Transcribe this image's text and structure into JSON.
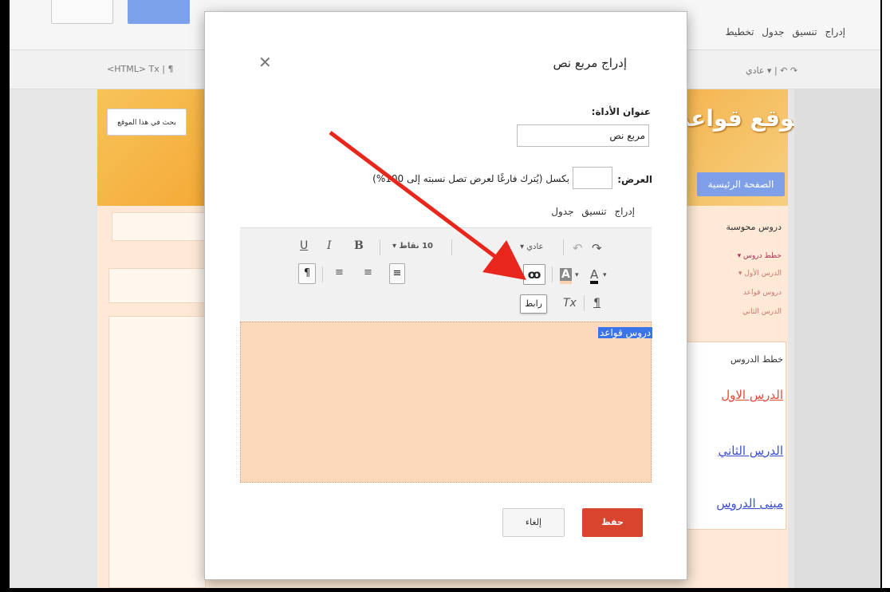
{
  "background": {
    "menu": [
      "إدراج",
      "تنسيق",
      "جدول",
      "تخطيط"
    ],
    "toolbar_left": "<HTML>  Tx  |  ¶",
    "toolbar_right": "عادي ▾  |  ↶  ↷",
    "site_title": "موقع قواعد",
    "home_button": "الصفحة الرئيسية",
    "search_button": "بحث في هذا الموقع",
    "sidebar_title": "دروس محوسبة",
    "sidebar_items": [
      "▾ خطط دروس",
      "▾ الدرس الأول",
      "دروس قواعد",
      "الدرس الثاني"
    ],
    "lessons_heading": "خطط الدروس",
    "lesson_links": [
      "الدرس الاول",
      "الدرس الثاني",
      "مبنى الدروس"
    ],
    "colors": {
      "accent_blue": "#7f9fe8",
      "link_red": "#e04a3a",
      "link_blue": "#3b4fd0"
    }
  },
  "modal": {
    "title": "إدراج مربع نص",
    "close_icon": "close-icon",
    "tool_title_label": "عنوان الأداة:",
    "tool_title_value": "مربع نص",
    "width_label": "العرض:",
    "width_hint": "بكسل (يُترك فارغًا لعرض تصل نسبته إلى 100%)",
    "editor_menu": [
      "إدراج",
      "تنسيق",
      "جدول"
    ],
    "toolbar": {
      "redo": "↷",
      "undo": "↶",
      "style_select": "عادي ▾",
      "size_select": "10 نقاط ▾",
      "bold": "B",
      "italic": "I",
      "underline": "U",
      "text_color": "A",
      "highlight": "A",
      "link_icon": "ꝏ",
      "link_tooltip": "رابط",
      "clear_format": "Tx",
      "paragraph": "¶",
      "align_right": "≡",
      "align_center": "≡",
      "align_left": "≡",
      "rtl": "¶"
    },
    "editor_selected_text": "دروس قواعد",
    "cancel_button": "إلغاء",
    "save_button": "حفظ",
    "colors": {
      "save": "#d9442f",
      "editor_bg": "#fdd9bb",
      "selection": "#3b73e8",
      "arrow": "#e8261c"
    }
  }
}
